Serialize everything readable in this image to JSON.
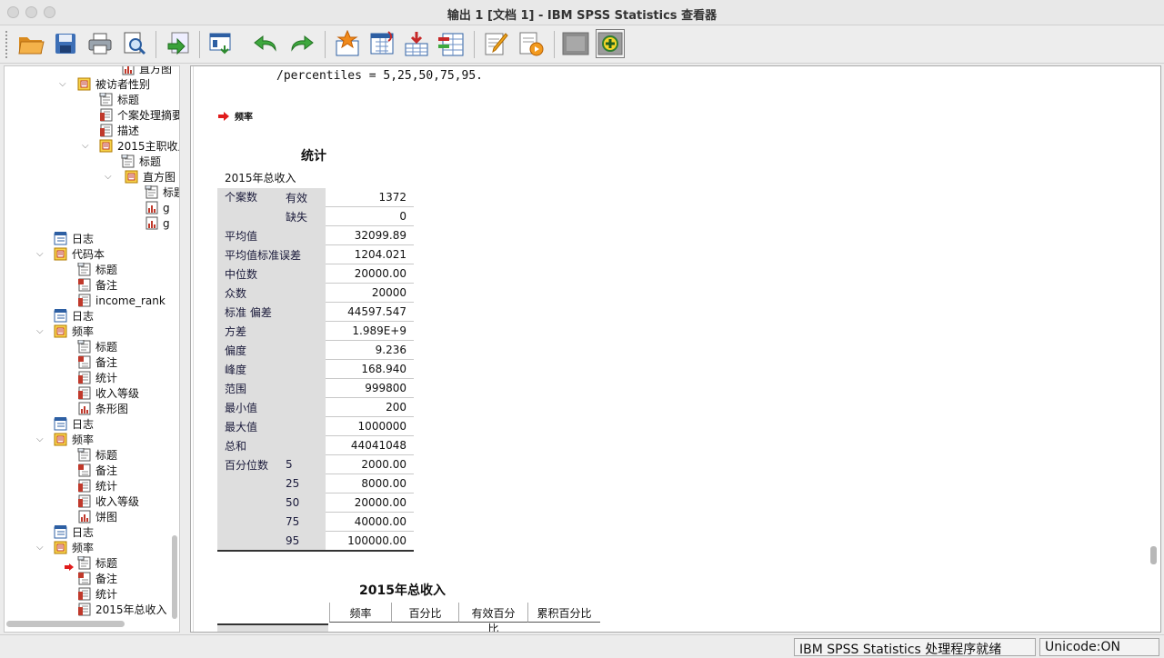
{
  "window": {
    "title": "输出 1 [文档 1] - IBM SPSS Statistics 查看器"
  },
  "toolbar": {
    "buttons": [
      {
        "name": "open-icon"
      },
      {
        "name": "save-icon"
      },
      {
        "name": "print-icon"
      },
      {
        "name": "print-preview-icon"
      },
      {
        "name": "export-icon"
      },
      {
        "name": "recall-dialog-icon"
      },
      {
        "name": "undo-icon"
      },
      {
        "name": "redo-icon"
      },
      {
        "name": "goto-case-icon"
      },
      {
        "name": "goto-variable-icon"
      },
      {
        "name": "insert-cases-icon"
      },
      {
        "name": "insert-variable-icon"
      },
      {
        "name": "edit-output-icon"
      },
      {
        "name": "designate-window-icon"
      },
      {
        "name": "hide-icon"
      },
      {
        "name": "show-icon"
      }
    ]
  },
  "tree": {
    "items": [
      {
        "label": "直方图",
        "icon": "chart"
      },
      {
        "label": "被访者性别",
        "icon": "book"
      },
      {
        "label": "标题",
        "icon": "doc"
      },
      {
        "label": "个案处理摘要",
        "icon": "table"
      },
      {
        "label": "描述",
        "icon": "table"
      },
      {
        "label": "2015主职收入",
        "icon": "book"
      },
      {
        "label": "标题",
        "icon": "doc"
      },
      {
        "label": "直方图",
        "icon": "book"
      },
      {
        "label": "标题",
        "icon": "doc"
      },
      {
        "label": "g",
        "icon": "chart"
      },
      {
        "label": "g",
        "icon": "chart"
      },
      {
        "label": "日志",
        "icon": "log"
      },
      {
        "label": "代码本",
        "icon": "book"
      },
      {
        "label": "标题",
        "icon": "doc"
      },
      {
        "label": "备注",
        "icon": "notes"
      },
      {
        "label": "income_rank",
        "icon": "table"
      },
      {
        "label": "日志",
        "icon": "log"
      },
      {
        "label": "频率",
        "icon": "book"
      },
      {
        "label": "标题",
        "icon": "doc"
      },
      {
        "label": "备注",
        "icon": "notes"
      },
      {
        "label": "统计",
        "icon": "table"
      },
      {
        "label": "收入等级",
        "icon": "table"
      },
      {
        "label": "条形图",
        "icon": "chart"
      },
      {
        "label": "日志",
        "icon": "log"
      },
      {
        "label": "频率",
        "icon": "book"
      },
      {
        "label": "标题",
        "icon": "doc"
      },
      {
        "label": "备注",
        "icon": "notes"
      },
      {
        "label": "统计",
        "icon": "table"
      },
      {
        "label": "收入等级",
        "icon": "table"
      },
      {
        "label": "饼图",
        "icon": "chart"
      },
      {
        "label": "日志",
        "icon": "log"
      },
      {
        "label": "频率",
        "icon": "book"
      },
      {
        "label": "标题",
        "icon": "doc"
      },
      {
        "label": "备注",
        "icon": "notes"
      },
      {
        "label": "统计",
        "icon": "table"
      },
      {
        "label": "2015年总收入",
        "icon": "table"
      }
    ]
  },
  "output": {
    "syntax_line": "/percentiles = 5,25,50,75,95.",
    "section_heading": "频率",
    "stat_table": {
      "title": "统计",
      "subtitle": "2015年总收入",
      "rows": [
        {
          "l1": "个案数",
          "l2": "有效",
          "v": "1372"
        },
        {
          "l1": "",
          "l2": "缺失",
          "v": "0"
        },
        {
          "l1": "平均值",
          "l2": "",
          "v": "32099.89"
        },
        {
          "l1": "平均值标准误差",
          "l2": "",
          "v": "1204.021"
        },
        {
          "l1": "中位数",
          "l2": "",
          "v": "20000.00"
        },
        {
          "l1": "众数",
          "l2": "",
          "v": "20000"
        },
        {
          "l1": "标准 偏差",
          "l2": "",
          "v": "44597.547"
        },
        {
          "l1": "方差",
          "l2": "",
          "v": "1.989E+9"
        },
        {
          "l1": "偏度",
          "l2": "",
          "v": "9.236"
        },
        {
          "l1": "峰度",
          "l2": "",
          "v": "168.940"
        },
        {
          "l1": "范围",
          "l2": "",
          "v": "999800"
        },
        {
          "l1": "最小值",
          "l2": "",
          "v": "200"
        },
        {
          "l1": "最大值",
          "l2": "",
          "v": "1000000"
        },
        {
          "l1": "总和",
          "l2": "",
          "v": "44041048"
        },
        {
          "l1": "百分位数",
          "l2": "5",
          "v": "2000.00"
        },
        {
          "l1": "",
          "l2": "25",
          "v": "8000.00"
        },
        {
          "l1": "",
          "l2": "50",
          "v": "20000.00"
        },
        {
          "l1": "",
          "l2": "75",
          "v": "40000.00"
        },
        {
          "l1": "",
          "l2": "95",
          "v": "100000.00"
        }
      ]
    },
    "freq_table": {
      "title": "2015年总收入",
      "columns": [
        "频率",
        "百分比",
        "有效百分比",
        "累积百分比"
      ]
    }
  },
  "status": {
    "processor": "IBM SPSS Statistics 处理程序就绪",
    "unicode": "Unicode:ON"
  }
}
